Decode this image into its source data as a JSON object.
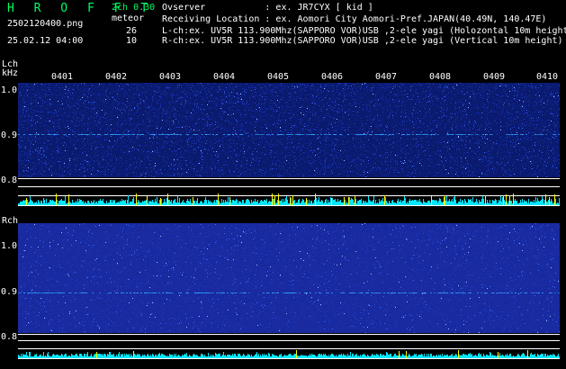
{
  "header": {
    "title": "H R O F F T",
    "version": "2ch 0.30",
    "mode": "meteor",
    "filename": "2502120400.png",
    "lch_count": "26",
    "rch_count": "10",
    "datetime": "25.02.12 04:00",
    "observer_line": "Ovserver           : ex. JR7CYX [ kid ]",
    "location_line": "Receiving Location : ex. Aomori City Aomori-Pref.JAPAN(40.49N, 140.47E)",
    "lch_line": "L-ch:ex. UV5R 113.900Mhz(SAPPORO VOR)USB ,2-ele yagi (Holozontal 10m height)",
    "rch_line": "R-ch:ex. UV5R 113.900Mhz(SAPPORO VOR)USB ,2-ele yagi (Vertical 10m height)"
  },
  "lch": {
    "label": "Lch",
    "unit": "kHz",
    "yticks": [
      "1.0",
      "0.9",
      "0.8"
    ]
  },
  "rch": {
    "label": "Rch",
    "yticks": [
      "1.0",
      "0.9",
      "0.8"
    ]
  },
  "xaxis": {
    "ticks": [
      "0401",
      "0402",
      "0403",
      "0404",
      "0405",
      "0406",
      "0407",
      "0408",
      "0409",
      "0410"
    ]
  },
  "colors": {
    "background": "#000000",
    "title_green": "#00ff66",
    "spectrogram_base": "#0a1a6e",
    "signal_line": "#2fa8ff",
    "bar_cyan": "#00e8ff",
    "bar_yellow": "#ffff00",
    "frame": "#ffffff"
  }
}
